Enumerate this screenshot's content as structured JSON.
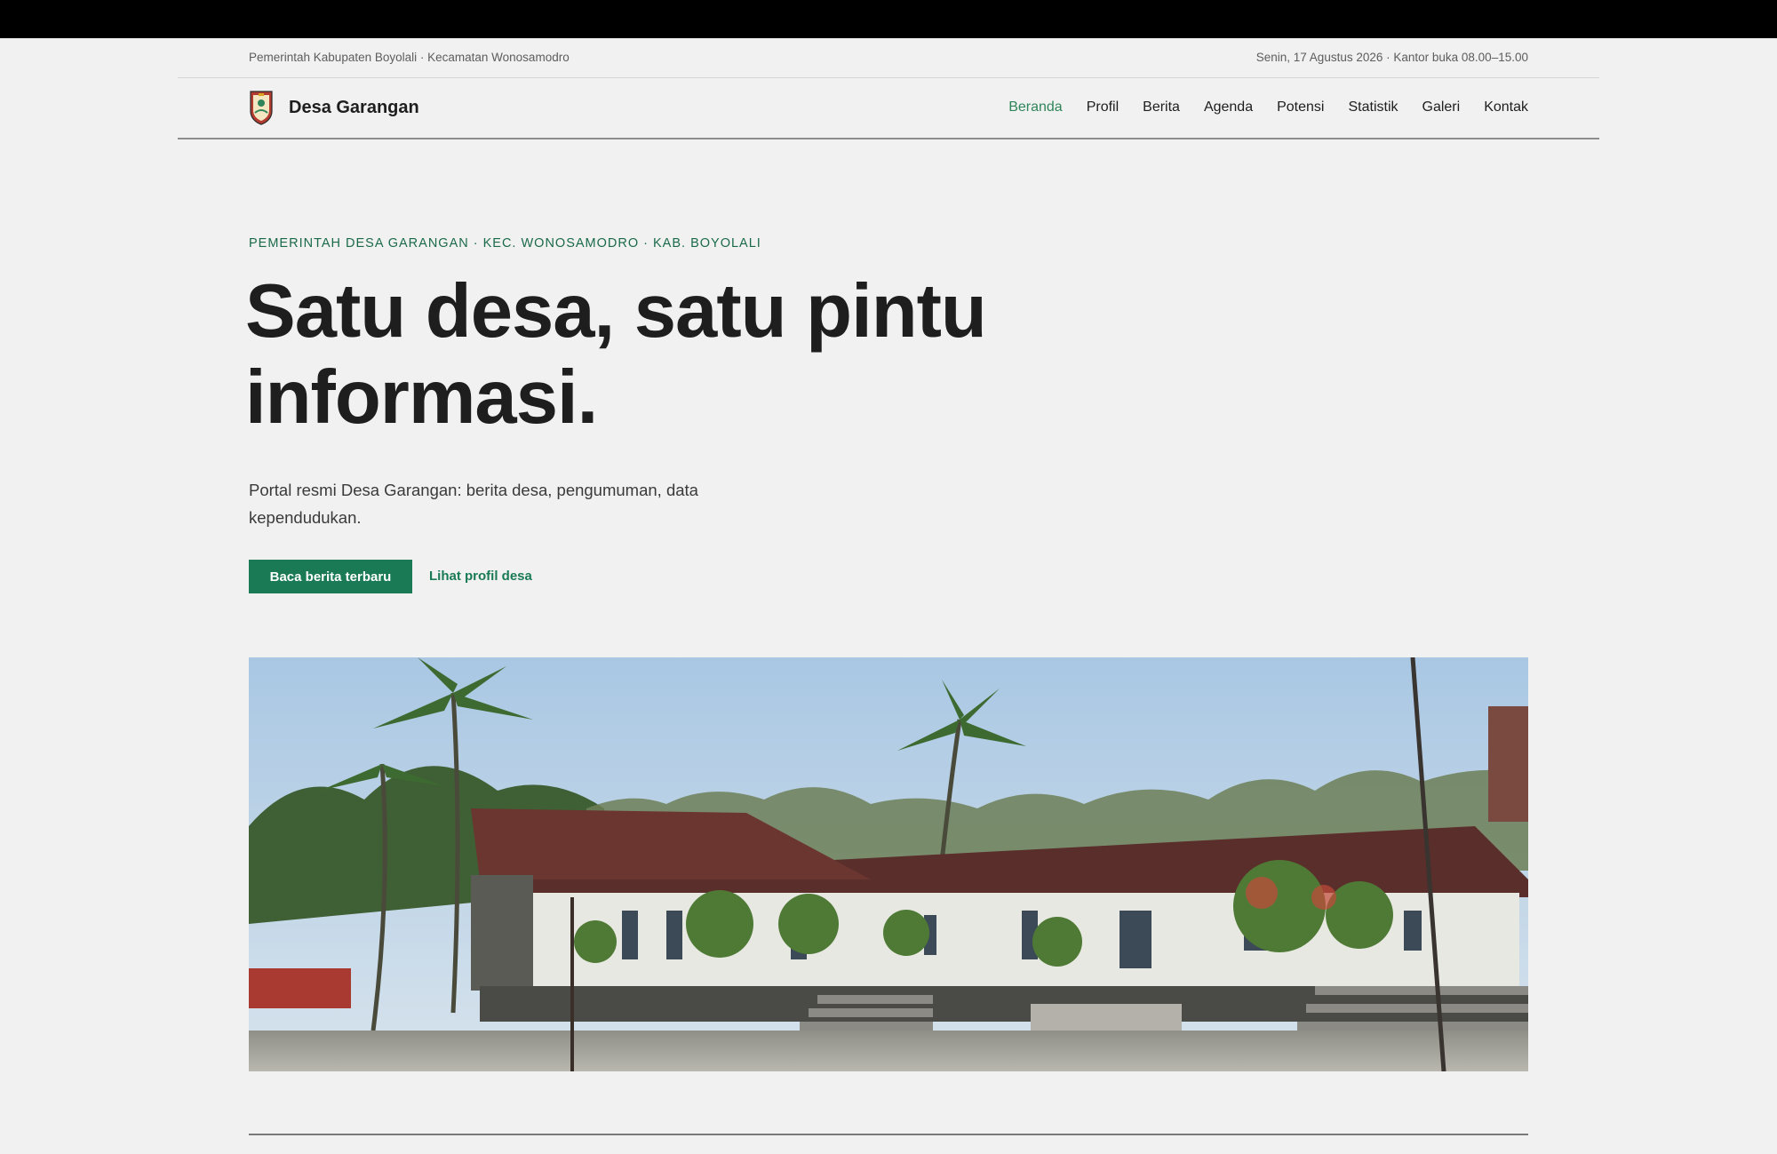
{
  "topbar": {
    "left_text": "Pemerintah Kabupaten Boyolali · Kecamatan Wonosamodro",
    "right_text": "Senin, 17 Agustus 2026 · Kantor buka 08.00–15.00"
  },
  "header": {
    "site_name": "Desa Garangan",
    "nav": [
      {
        "label": "Beranda",
        "active": true
      },
      {
        "label": "Profil"
      },
      {
        "label": "Berita"
      },
      {
        "label": "Agenda"
      },
      {
        "label": "Potensi"
      },
      {
        "label": "Statistik"
      },
      {
        "label": "Galeri"
      },
      {
        "label": "Kontak"
      }
    ]
  },
  "hero": {
    "eyebrow": "PEMERINTAH DESA GARANGAN · KEC. WONOSAMODRO · KAB. BOYOLALI",
    "headline_line1": "Satu desa, satu pintu",
    "headline_line2": "informasi.",
    "lead": "Portal resmi Desa Garangan: berita desa, pengumuman, data kependudukan.",
    "primary_button": "Baca berita terbaru",
    "secondary_link": "Lihat profil desa"
  },
  "colors": {
    "accent": "#1a7a55",
    "nav_active": "#2f855a",
    "background": "#f1f1f1"
  },
  "icons": {
    "brand": "village-emblem-icon"
  }
}
